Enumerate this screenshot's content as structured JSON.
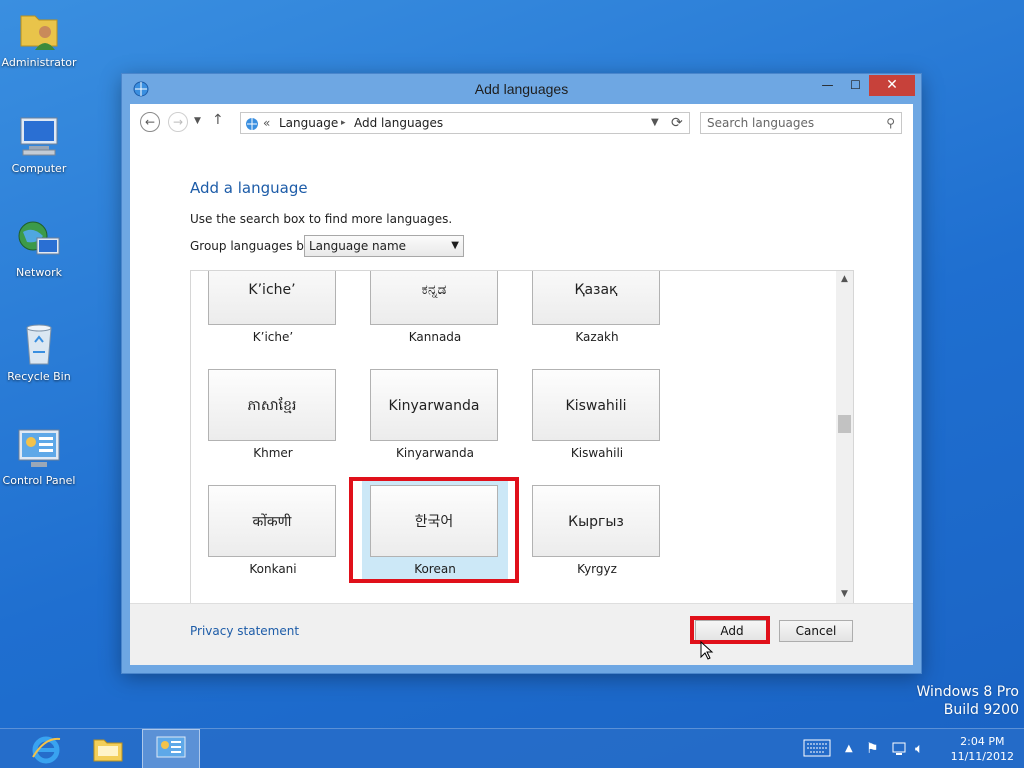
{
  "desktop": {
    "icons": [
      {
        "label": "Administrator"
      },
      {
        "label": "Computer"
      },
      {
        "label": "Network"
      },
      {
        "label": "Recycle Bin"
      },
      {
        "label": "Control Panel"
      }
    ],
    "watermark_line1": "Windows 8 Pro",
    "watermark_line2": "Build 9200"
  },
  "window": {
    "title": "Add languages",
    "controls": {
      "minimize": "—",
      "maximize": "☐",
      "close": "✕"
    },
    "address": {
      "prefix": "«",
      "crumb1": "Language",
      "separator": "▸",
      "crumb2": "Add languages"
    },
    "search": {
      "placeholder": "Search languages"
    },
    "heading": "Add a language",
    "helptext": "Use the search box to find more languages.",
    "group_label": "Group languages by:",
    "group_value": "Language name",
    "languages": [
      {
        "native": "K’iche’",
        "name": "K’iche’"
      },
      {
        "native": "ಕನ್ನಡ",
        "name": "Kannada"
      },
      {
        "native": "Қазақ",
        "name": "Kazakh"
      },
      {
        "native": "ភាសាខ្មែរ",
        "name": "Khmer"
      },
      {
        "native": "Kinyarwanda",
        "name": "Kinyarwanda"
      },
      {
        "native": "Kiswahili",
        "name": "Kiswahili"
      },
      {
        "native": "कोंकणी",
        "name": "Konkani"
      },
      {
        "native": "한국어",
        "name": "Korean",
        "selected": true
      },
      {
        "native": "Кыргыз",
        "name": "Kyrgyz"
      }
    ],
    "footer": {
      "privacy": "Privacy statement",
      "add": "Add",
      "cancel": "Cancel"
    }
  },
  "taskbar": {
    "time": "2:04 PM",
    "date": "11/11/2012"
  },
  "colors": {
    "accent_link": "#1d5ca8",
    "highlight": "#e0101a",
    "selected_bg": "#cce8f7"
  }
}
